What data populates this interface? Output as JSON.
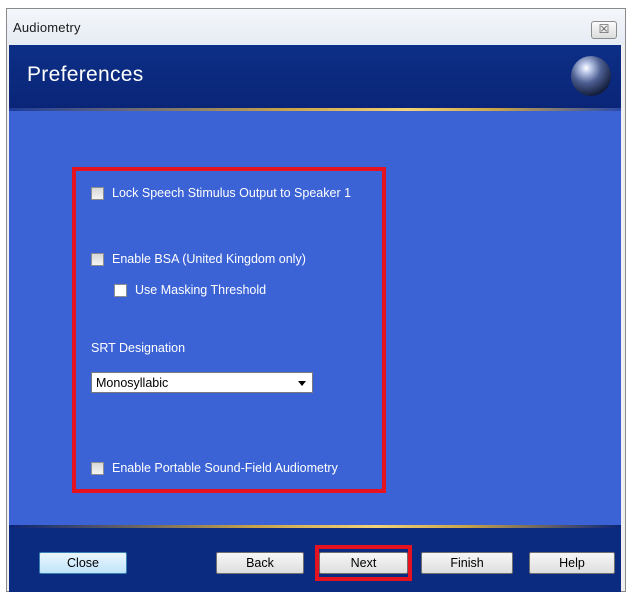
{
  "window": {
    "title": "Audiometry",
    "close_glyph": "☒"
  },
  "header": {
    "title": "Preferences",
    "icon": "orb-icon"
  },
  "options": {
    "lock_speech": {
      "label": "Lock Speech Stimulus Output to Speaker 1",
      "checked": false
    },
    "enable_bsa": {
      "label": "Enable BSA (United Kingdom only)",
      "checked": false
    },
    "use_masking": {
      "label": "Use Masking Threshold",
      "checked": false
    },
    "srt_label": "SRT Designation",
    "srt_value": "Monosyllabic",
    "portable": {
      "label": "Enable Portable Sound-Field Audiometry",
      "checked": false
    }
  },
  "buttons": {
    "close": "Close",
    "back": "Back",
    "next": "Next",
    "finish": "Finish",
    "help": "Help"
  },
  "colors": {
    "header": "#0c2f86",
    "panel": "#3b63d6",
    "highlight": "#e4131f",
    "footer": "#0b2b80"
  }
}
